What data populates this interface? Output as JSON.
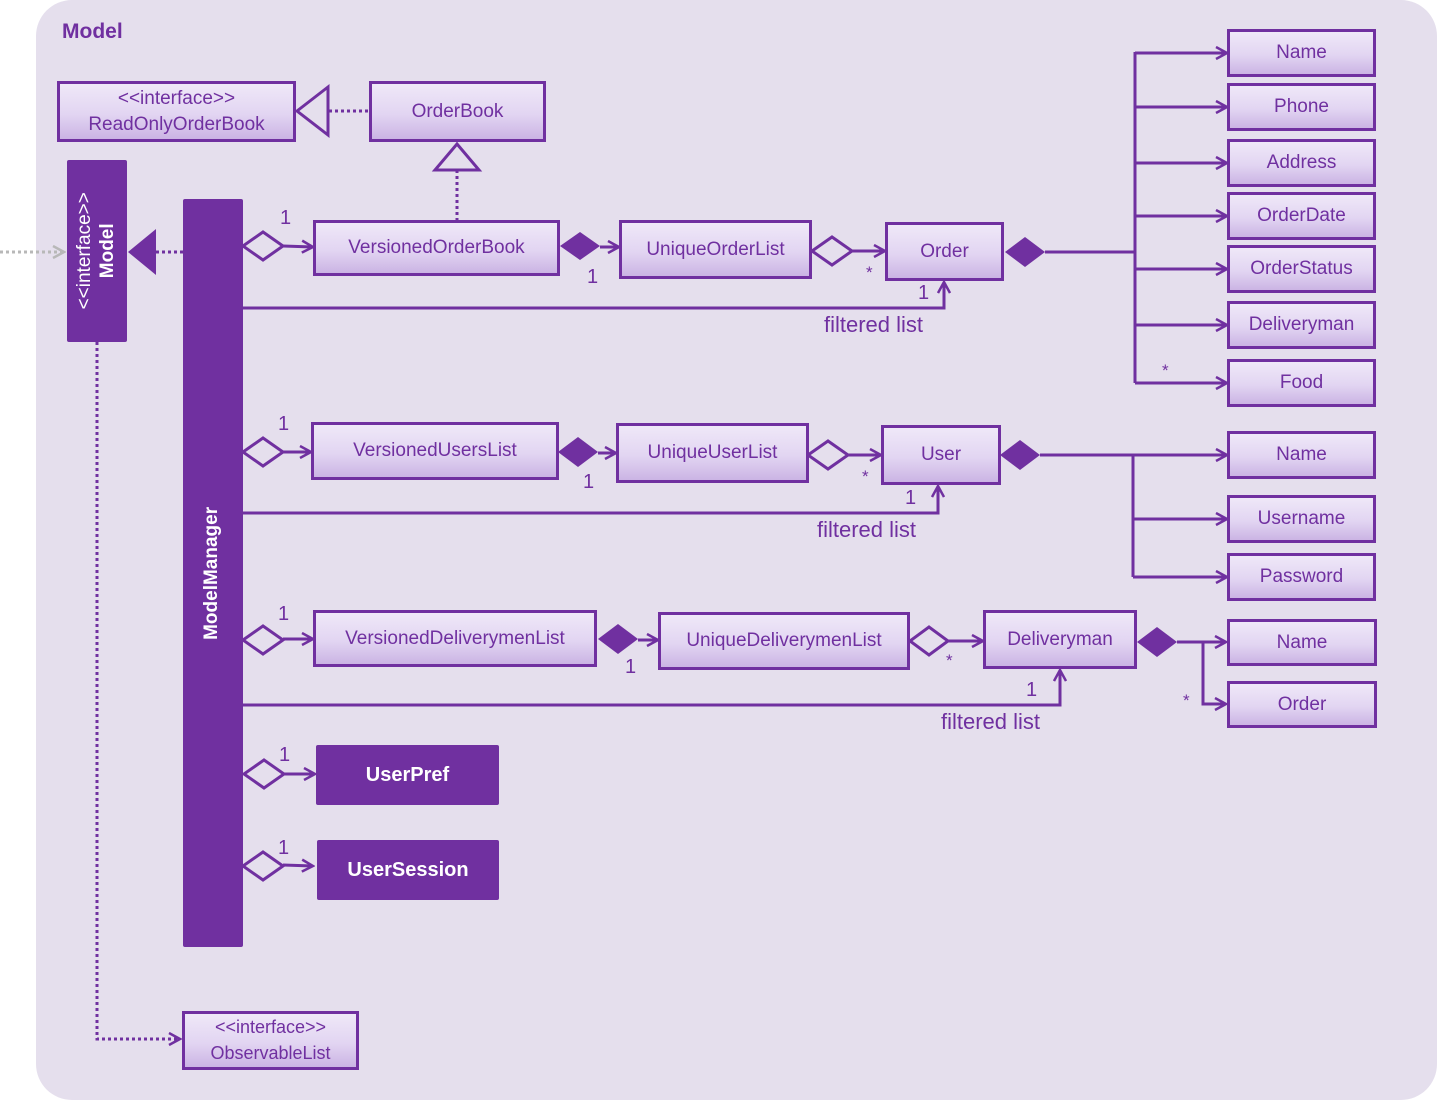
{
  "package": {
    "title": "Model"
  },
  "colors": {
    "primary": "#7030a0",
    "background": "#e5dfed",
    "external_arrow": "#b8b8b8"
  },
  "classes": {
    "read_only_order_book": {
      "stereotype": "<<interface>>",
      "name": "ReadOnlyOrderBook"
    },
    "order_book": {
      "name": "OrderBook"
    },
    "model": {
      "stereotype": "<<interface>>",
      "name": "Model"
    },
    "model_manager": {
      "name": "ModelManager"
    },
    "versioned_order_book": {
      "name": "VersionedOrderBook"
    },
    "unique_order_list": {
      "name": "UniqueOrderList"
    },
    "order": {
      "name": "Order"
    },
    "versioned_users_list": {
      "name": "VersionedUsersList"
    },
    "unique_user_list": {
      "name": "UniqueUserList"
    },
    "user": {
      "name": "User"
    },
    "versioned_deliverymen_list": {
      "name": "VersionedDeliverymenList"
    },
    "unique_deliverymen_list": {
      "name": "UniqueDeliverymenList"
    },
    "deliveryman": {
      "name": "Deliveryman"
    },
    "user_pref": {
      "name": "UserPref"
    },
    "user_session": {
      "name": "UserSession"
    },
    "observable_list": {
      "stereotype": "<<interface>>",
      "name": "ObservableList"
    }
  },
  "order_attributes": [
    "Name",
    "Phone",
    "Address",
    "OrderDate",
    "OrderStatus",
    "Deliveryman",
    "Food"
  ],
  "user_attributes": [
    "Name",
    "Username",
    "Password"
  ],
  "deliveryman_attributes": [
    "Name",
    "Order"
  ],
  "multiplicities": {
    "one": "1",
    "many": "*"
  },
  "edge_labels": {
    "filtered_list": "filtered list"
  }
}
